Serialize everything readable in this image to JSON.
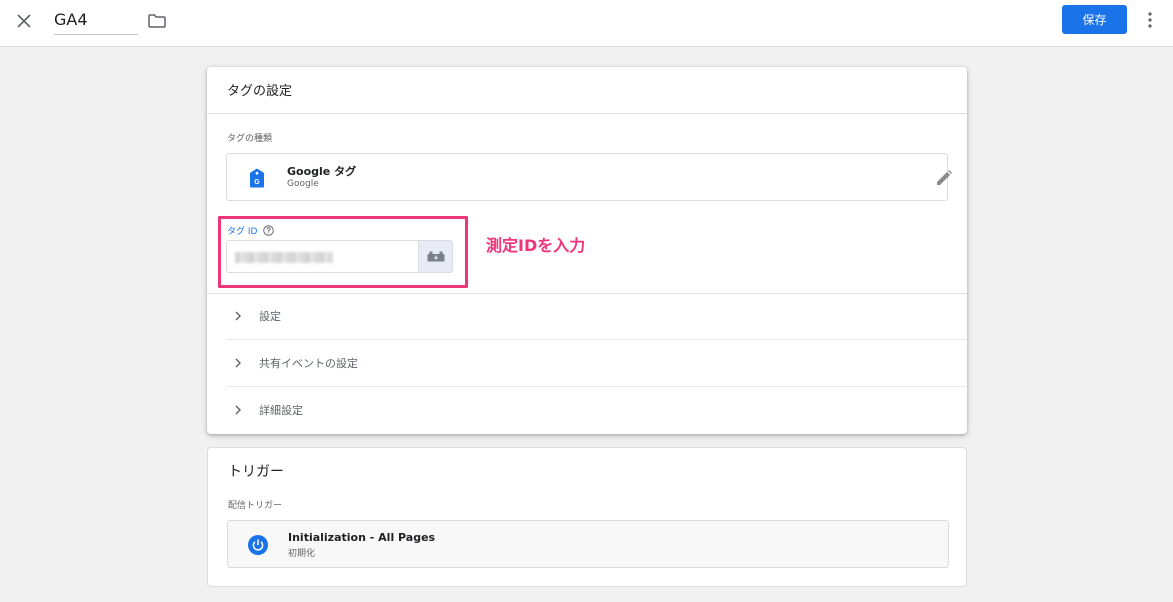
{
  "topbar": {
    "tag_name": "GA4",
    "save_label": "保存"
  },
  "tag_config": {
    "title": "タグの設定",
    "tag_type_label": "タグの種類",
    "tag_type": {
      "name": "Google タグ",
      "vendor": "Google",
      "icon": "google-tag-icon"
    },
    "tag_id_label": "タグ ID",
    "tag_id_value": "",
    "annotation": "測定IDを入力",
    "sections": [
      {
        "label": "設定"
      },
      {
        "label": "共有イベントの設定"
      },
      {
        "label": "詳細設定"
      }
    ]
  },
  "trigger": {
    "title": "トリガー",
    "firing_label": "配信トリガー",
    "name": "Initialization - All Pages",
    "subtitle": "初期化",
    "icon": "power-icon"
  },
  "colors": {
    "accent": "#1a73e8",
    "annotation": "#f0357a",
    "background": "#f1f1f1"
  }
}
